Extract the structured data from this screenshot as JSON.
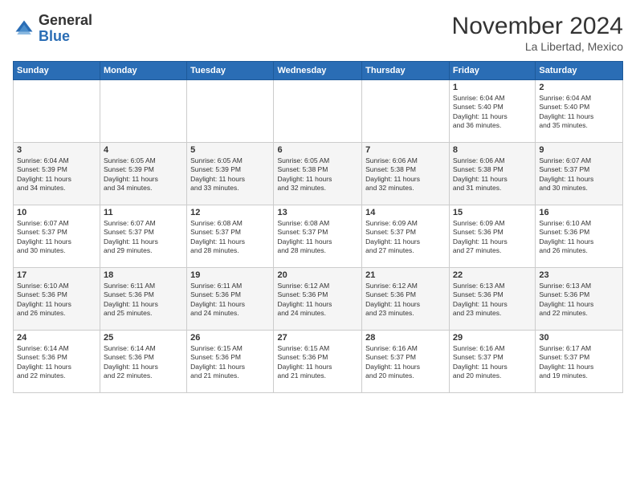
{
  "header": {
    "logo_line1": "General",
    "logo_line2": "Blue",
    "month": "November 2024",
    "location": "La Libertad, Mexico"
  },
  "weekdays": [
    "Sunday",
    "Monday",
    "Tuesday",
    "Wednesday",
    "Thursday",
    "Friday",
    "Saturday"
  ],
  "weeks": [
    [
      {
        "day": "",
        "info": ""
      },
      {
        "day": "",
        "info": ""
      },
      {
        "day": "",
        "info": ""
      },
      {
        "day": "",
        "info": ""
      },
      {
        "day": "",
        "info": ""
      },
      {
        "day": "1",
        "info": "Sunrise: 6:04 AM\nSunset: 5:40 PM\nDaylight: 11 hours\nand 36 minutes."
      },
      {
        "day": "2",
        "info": "Sunrise: 6:04 AM\nSunset: 5:40 PM\nDaylight: 11 hours\nand 35 minutes."
      }
    ],
    [
      {
        "day": "3",
        "info": "Sunrise: 6:04 AM\nSunset: 5:39 PM\nDaylight: 11 hours\nand 34 minutes."
      },
      {
        "day": "4",
        "info": "Sunrise: 6:05 AM\nSunset: 5:39 PM\nDaylight: 11 hours\nand 34 minutes."
      },
      {
        "day": "5",
        "info": "Sunrise: 6:05 AM\nSunset: 5:39 PM\nDaylight: 11 hours\nand 33 minutes."
      },
      {
        "day": "6",
        "info": "Sunrise: 6:05 AM\nSunset: 5:38 PM\nDaylight: 11 hours\nand 32 minutes."
      },
      {
        "day": "7",
        "info": "Sunrise: 6:06 AM\nSunset: 5:38 PM\nDaylight: 11 hours\nand 32 minutes."
      },
      {
        "day": "8",
        "info": "Sunrise: 6:06 AM\nSunset: 5:38 PM\nDaylight: 11 hours\nand 31 minutes."
      },
      {
        "day": "9",
        "info": "Sunrise: 6:07 AM\nSunset: 5:37 PM\nDaylight: 11 hours\nand 30 minutes."
      }
    ],
    [
      {
        "day": "10",
        "info": "Sunrise: 6:07 AM\nSunset: 5:37 PM\nDaylight: 11 hours\nand 30 minutes."
      },
      {
        "day": "11",
        "info": "Sunrise: 6:07 AM\nSunset: 5:37 PM\nDaylight: 11 hours\nand 29 minutes."
      },
      {
        "day": "12",
        "info": "Sunrise: 6:08 AM\nSunset: 5:37 PM\nDaylight: 11 hours\nand 28 minutes."
      },
      {
        "day": "13",
        "info": "Sunrise: 6:08 AM\nSunset: 5:37 PM\nDaylight: 11 hours\nand 28 minutes."
      },
      {
        "day": "14",
        "info": "Sunrise: 6:09 AM\nSunset: 5:37 PM\nDaylight: 11 hours\nand 27 minutes."
      },
      {
        "day": "15",
        "info": "Sunrise: 6:09 AM\nSunset: 5:36 PM\nDaylight: 11 hours\nand 27 minutes."
      },
      {
        "day": "16",
        "info": "Sunrise: 6:10 AM\nSunset: 5:36 PM\nDaylight: 11 hours\nand 26 minutes."
      }
    ],
    [
      {
        "day": "17",
        "info": "Sunrise: 6:10 AM\nSunset: 5:36 PM\nDaylight: 11 hours\nand 26 minutes."
      },
      {
        "day": "18",
        "info": "Sunrise: 6:11 AM\nSunset: 5:36 PM\nDaylight: 11 hours\nand 25 minutes."
      },
      {
        "day": "19",
        "info": "Sunrise: 6:11 AM\nSunset: 5:36 PM\nDaylight: 11 hours\nand 24 minutes."
      },
      {
        "day": "20",
        "info": "Sunrise: 6:12 AM\nSunset: 5:36 PM\nDaylight: 11 hours\nand 24 minutes."
      },
      {
        "day": "21",
        "info": "Sunrise: 6:12 AM\nSunset: 5:36 PM\nDaylight: 11 hours\nand 23 minutes."
      },
      {
        "day": "22",
        "info": "Sunrise: 6:13 AM\nSunset: 5:36 PM\nDaylight: 11 hours\nand 23 minutes."
      },
      {
        "day": "23",
        "info": "Sunrise: 6:13 AM\nSunset: 5:36 PM\nDaylight: 11 hours\nand 22 minutes."
      }
    ],
    [
      {
        "day": "24",
        "info": "Sunrise: 6:14 AM\nSunset: 5:36 PM\nDaylight: 11 hours\nand 22 minutes."
      },
      {
        "day": "25",
        "info": "Sunrise: 6:14 AM\nSunset: 5:36 PM\nDaylight: 11 hours\nand 22 minutes."
      },
      {
        "day": "26",
        "info": "Sunrise: 6:15 AM\nSunset: 5:36 PM\nDaylight: 11 hours\nand 21 minutes."
      },
      {
        "day": "27",
        "info": "Sunrise: 6:15 AM\nSunset: 5:36 PM\nDaylight: 11 hours\nand 21 minutes."
      },
      {
        "day": "28",
        "info": "Sunrise: 6:16 AM\nSunset: 5:37 PM\nDaylight: 11 hours\nand 20 minutes."
      },
      {
        "day": "29",
        "info": "Sunrise: 6:16 AM\nSunset: 5:37 PM\nDaylight: 11 hours\nand 20 minutes."
      },
      {
        "day": "30",
        "info": "Sunrise: 6:17 AM\nSunset: 5:37 PM\nDaylight: 11 hours\nand 19 minutes."
      }
    ]
  ]
}
